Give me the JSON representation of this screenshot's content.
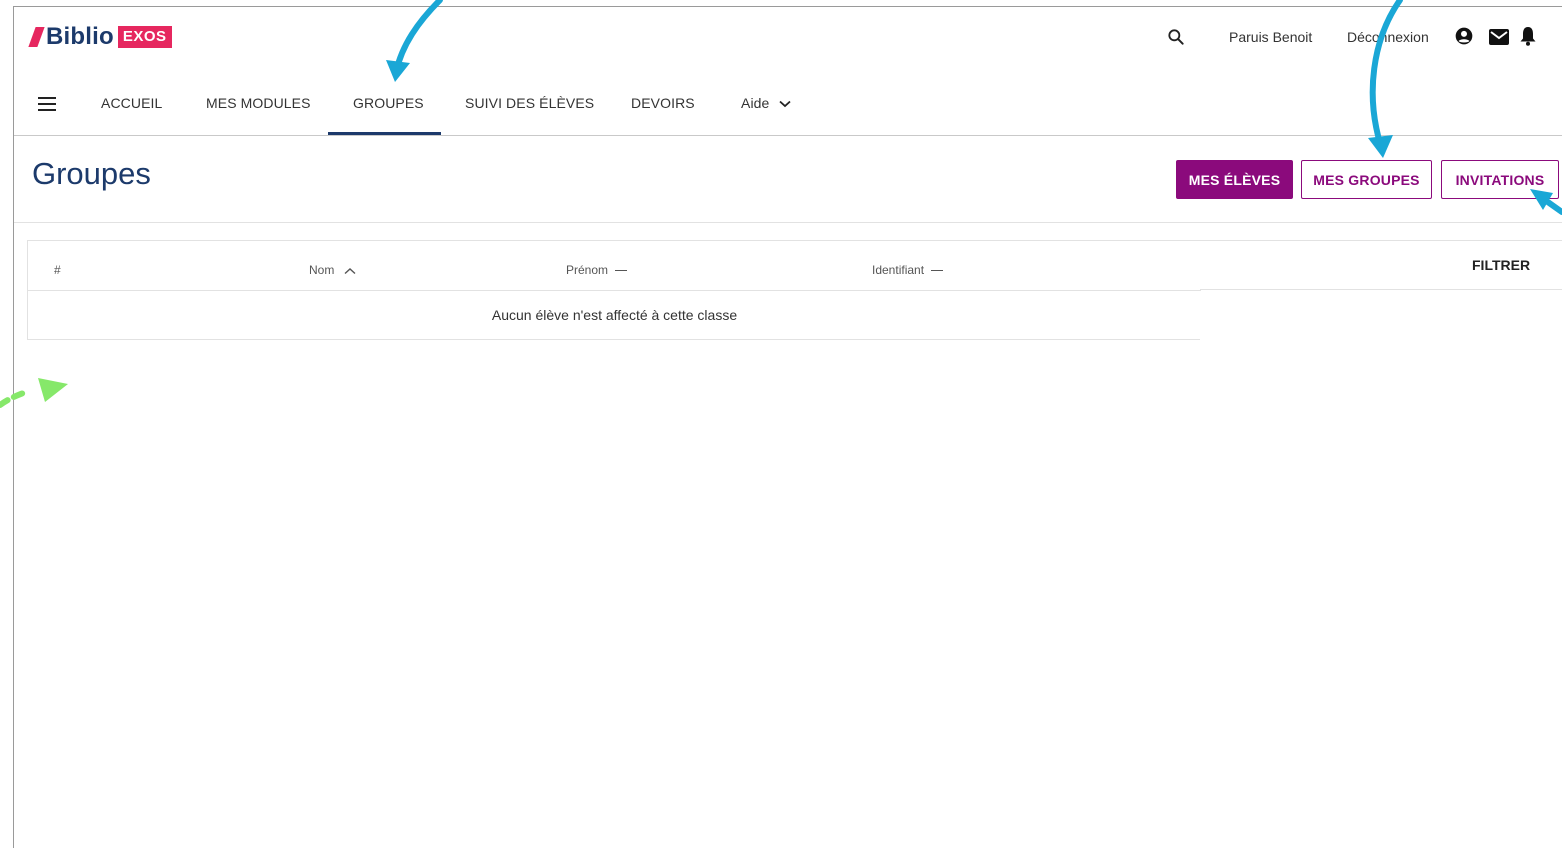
{
  "brand": {
    "name": "Biblio",
    "badge": "EXOS"
  },
  "topbar": {
    "user_name": "Paruis Benoit",
    "logout_label": "Déconnexion"
  },
  "icons": {
    "search": "search-icon",
    "account": "account-circle-icon",
    "mail": "mail-icon",
    "bell": "bell-icon",
    "menu": "menu-icon",
    "chevron": "chevron-down-icon",
    "sort_asc": "chevron-up-icon"
  },
  "nav": {
    "items": [
      {
        "label": "ACCUEIL"
      },
      {
        "label": "MES MODULES"
      },
      {
        "label": "GROUPES",
        "active": true
      },
      {
        "label": "SUIVI DES ÉLÈVES"
      },
      {
        "label": "DEVOIRS"
      },
      {
        "label": "Aide"
      }
    ]
  },
  "page": {
    "title": "Groupes",
    "buttons": {
      "eleves": "MES ÉLÈVES",
      "groupes": "MES GROUPES",
      "invitations": "INVITATIONS"
    }
  },
  "table": {
    "columns": [
      "#",
      "Nom",
      "Prénom",
      "Identifiant"
    ],
    "sort_column": "Nom",
    "empty_message": "Aucun élève n'est affecté à cette classe",
    "filter_label": "FILTRER"
  },
  "colors": {
    "brand_navy": "#1c3a6b",
    "brand_pink": "#e6275f",
    "accent_purple": "#8b0a7c",
    "annotation_blue": "#1aa7d6",
    "annotation_green": "#86e86a"
  }
}
